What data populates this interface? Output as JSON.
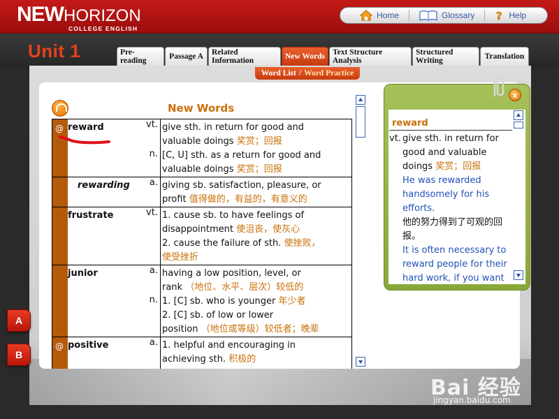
{
  "app": {
    "brand_main": "NEW",
    "brand_second": "HORIZON",
    "brand_sub": "COLLEGE ENGLISH"
  },
  "topnav": {
    "home": "Home",
    "glossary": "Glossary",
    "help": "Help"
  },
  "unit_title": "Unit 1",
  "tabs": [
    {
      "label": "Pre-reading",
      "active": false
    },
    {
      "label": "Passage A",
      "active": false
    },
    {
      "label": "Related Information",
      "active": false
    },
    {
      "label": "New Words",
      "active": true
    },
    {
      "label": "Text Structure Analysis",
      "active": false
    },
    {
      "label": "Structured Writing",
      "active": false
    },
    {
      "label": "Translation",
      "active": false
    }
  ],
  "subtabs": {
    "word_list": "Word List",
    "separator": "/",
    "word_practice": "Word Practice"
  },
  "new_words_title": "New Words",
  "vocab": [
    {
      "marker": "@",
      "word": "reward",
      "derivative": false,
      "defs": [
        {
          "pos": "vt.",
          "lines": [
            [
              "give sth. in return for good and",
              ""
            ],
            [
              "valuable doings ",
              "奖赏；回报"
            ]
          ]
        },
        {
          "pos": "n.",
          "lines": [
            [
              "[C, U] sth. as a return for good and",
              ""
            ],
            [
              "valuable doings ",
              "奖赏；回报"
            ]
          ]
        }
      ]
    },
    {
      "marker": "",
      "word": "rewarding",
      "derivative": true,
      "defs": [
        {
          "pos": "a.",
          "lines": [
            [
              "giving sb. satisfaction, pleasure, or",
              ""
            ],
            [
              "profit ",
              "值得做的，有益的，有意义的"
            ]
          ]
        }
      ]
    },
    {
      "marker": "",
      "word": "frustrate",
      "derivative": false,
      "defs": [
        {
          "pos": "vt.",
          "lines": [
            [
              "1. cause sb. to have feelings of",
              ""
            ],
            [
              "disappointment ",
              "使沮丧，使灰心"
            ],
            [
              "2. cause the failure of sth. ",
              "使挫败，"
            ],
            [
              "",
              "使受挫折"
            ]
          ]
        }
      ]
    },
    {
      "marker": "",
      "word": "junior",
      "derivative": false,
      "defs": [
        {
          "pos": "a.",
          "lines": [
            [
              "having a low position, level, or",
              ""
            ],
            [
              "rank ",
              "（地位、水平、层次）较低的"
            ]
          ]
        },
        {
          "pos": "n.",
          "lines": [
            [
              "1. [C] sb. who is younger ",
              "年少者"
            ],
            [
              "2. [C] sb. of low or lower",
              ""
            ],
            [
              "position ",
              "（地位或等级）较低者；晚辈"
            ]
          ]
        }
      ]
    },
    {
      "marker": "@",
      "word": "positive",
      "derivative": false,
      "defs": [
        {
          "pos": "a.",
          "lines": [
            [
              "1. helpful and encouraging in",
              ""
            ],
            [
              "achieving sth. ",
              "积极的"
            ]
          ]
        }
      ]
    }
  ],
  "popup": {
    "word": "reward",
    "pos": "vt.",
    "def_lines": [
      "give sth. in return for",
      "good and valuable"
    ],
    "def_last": "doings ",
    "def_cn": "奖赏；回报",
    "example1": [
      "He was rewarded",
      "handsomely for his",
      "efforts."
    ],
    "example1_cn": [
      "他的努力得到了可观的回",
      "报。"
    ],
    "example2": [
      "It is often necessary to",
      "reward people for their",
      "hard work, if you want"
    ],
    "close_label": "x"
  },
  "side_buttons": [
    "A",
    "B"
  ],
  "watermark": {
    "text": "Bai 经验",
    "url": "jingyan.baidu.com"
  },
  "colors": {
    "header_red": "#b01412",
    "tab_active": "#d84a1a",
    "word_strip": "#b35a0b",
    "chinese_text": "#c8700a",
    "example_blue": "#2350b8",
    "popup_green": "#98b448"
  }
}
